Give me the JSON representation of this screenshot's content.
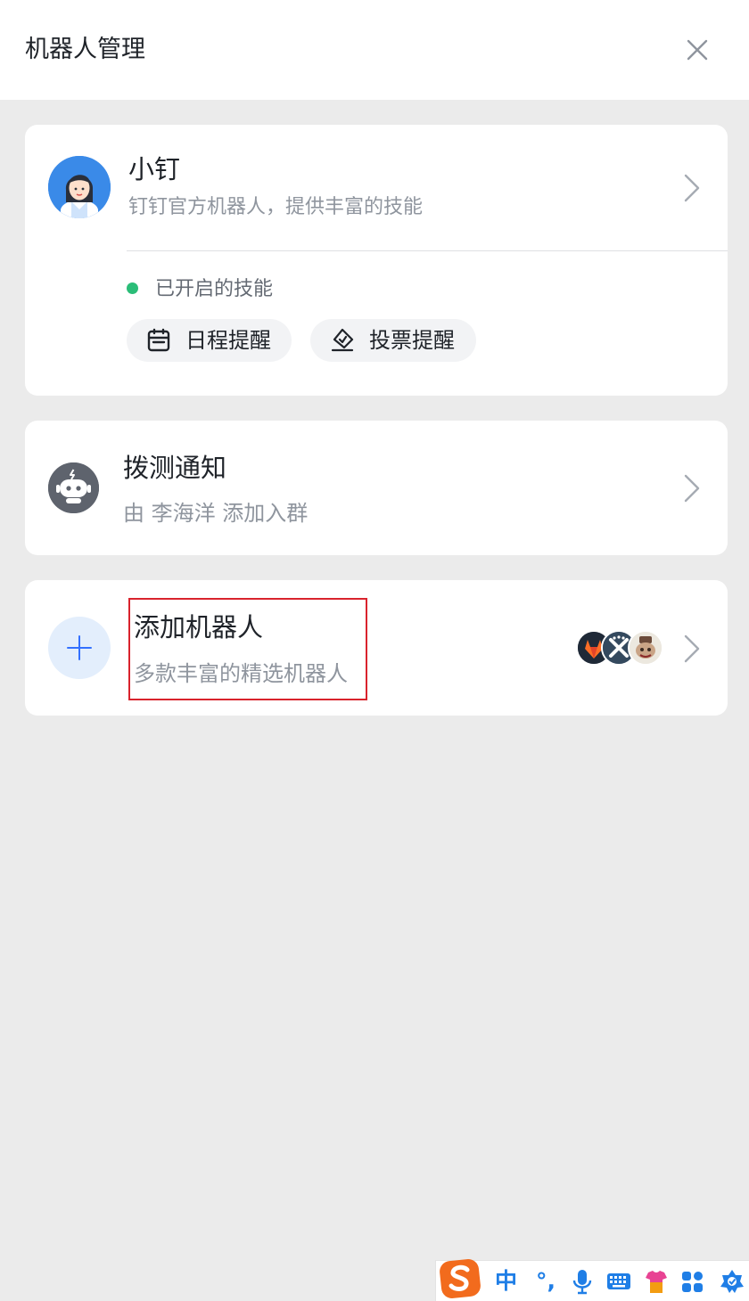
{
  "header": {
    "title": "机器人管理",
    "close_icon": "close-icon"
  },
  "robots": [
    {
      "name": "小钉",
      "desc": "钉钉官方机器人，提供丰富的技能",
      "enabled_skills_label": "已开启的技能",
      "status_color": "#2bbd78",
      "skills": [
        {
          "label": "日程提醒",
          "icon": "calendar-icon"
        },
        {
          "label": "投票提醒",
          "icon": "vote-icon"
        }
      ]
    },
    {
      "name": "拨测通知",
      "desc": "由 李海洋 添加入群"
    }
  ],
  "add_robot": {
    "title": "添加机器人",
    "desc": "多款丰富的精选机器人",
    "preview_icons": [
      "gitlab-icon",
      "jenkins-icon",
      "robot-avatar-icon"
    ]
  },
  "ime_toolbar": {
    "logo": "sogou-s-icon",
    "mode_label": "中",
    "punct_label": "°,",
    "items": [
      "microphone-icon",
      "keyboard-icon",
      "skin-icon",
      "apps-icon",
      "settings-icon"
    ]
  },
  "colors": {
    "accent_blue": "#3370ff",
    "highlight_red": "#d9232d",
    "ime_blue": "#1f7ee6"
  }
}
